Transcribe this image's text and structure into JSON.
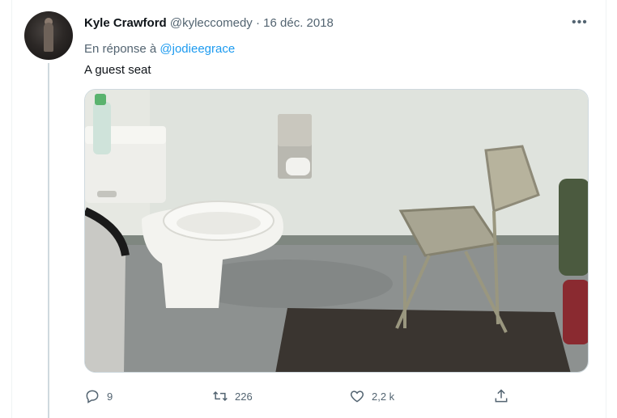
{
  "tweet": {
    "author_name": "Kyle Crawford",
    "author_handle": "@kyleccomedy",
    "separator": "·",
    "date": "16 déc. 2018",
    "reply_prefix": "En réponse à",
    "reply_to": "@jodieegrace",
    "text": "A guest seat",
    "more_icon": "more-horizontal-icon"
  },
  "actions": {
    "reply": {
      "icon": "reply-icon",
      "count": "9"
    },
    "retweet": {
      "icon": "retweet-icon",
      "count": "226"
    },
    "like": {
      "icon": "heart-icon",
      "count": "2,2 k"
    },
    "share": {
      "icon": "share-icon"
    }
  },
  "colors": {
    "link": "#1d9bf0",
    "secondary": "#536471",
    "primary": "#0f1419"
  }
}
